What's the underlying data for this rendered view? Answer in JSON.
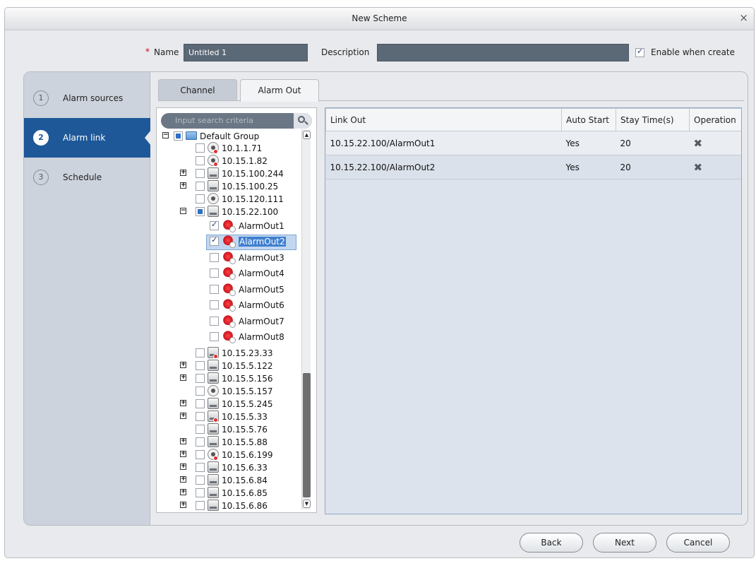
{
  "window": {
    "title": "New Scheme",
    "close_icon": "×"
  },
  "form": {
    "required_mark": "*",
    "name_label": "Name",
    "name_value": "Untitled 1",
    "description_label": "Description",
    "description_value": "",
    "enable_label": "Enable when create",
    "enable_checked": true
  },
  "steps": [
    {
      "num": "1",
      "label": "Alarm sources",
      "active": false
    },
    {
      "num": "2",
      "label": "Alarm link",
      "active": true
    },
    {
      "num": "3",
      "label": "Schedule",
      "active": false
    }
  ],
  "tabs": [
    {
      "label": "Channel",
      "active": false
    },
    {
      "label": "Alarm Out",
      "active": true
    }
  ],
  "search": {
    "placeholder": "Input search criteria"
  },
  "tree": {
    "root": "Default Group",
    "nodes": [
      "10.1.1.71",
      "10.15.1.82",
      "10.15.100.244",
      "10.15.100.25",
      "10.15.120.111",
      "10.15.22.100",
      "AlarmOut1",
      "AlarmOut2",
      "AlarmOut3",
      "AlarmOut4",
      "AlarmOut5",
      "AlarmOut6",
      "AlarmOut7",
      "AlarmOut8",
      "10.15.23.33",
      "10.15.5.122",
      "10.15.5.156",
      "10.15.5.157",
      "10.15.5.245",
      "10.15.5.33",
      "10.15.5.76",
      "10.15.5.88",
      "10.15.6.199",
      "10.15.6.33",
      "10.15.6.84",
      "10.15.6.85",
      "10.15.6.86"
    ]
  },
  "grid": {
    "headers": [
      "Link Out",
      "Auto Start",
      "Stay Time(s)",
      "Operation"
    ],
    "rows": [
      {
        "link_out": "10.15.22.100/AlarmOut1",
        "auto_start": "Yes",
        "stay_time": "20",
        "operation": "✖"
      },
      {
        "link_out": "10.15.22.100/AlarmOut2",
        "auto_start": "Yes",
        "stay_time": "20",
        "operation": "✖"
      }
    ]
  },
  "buttons": {
    "back": "Back",
    "next": "Next",
    "cancel": "Cancel"
  }
}
